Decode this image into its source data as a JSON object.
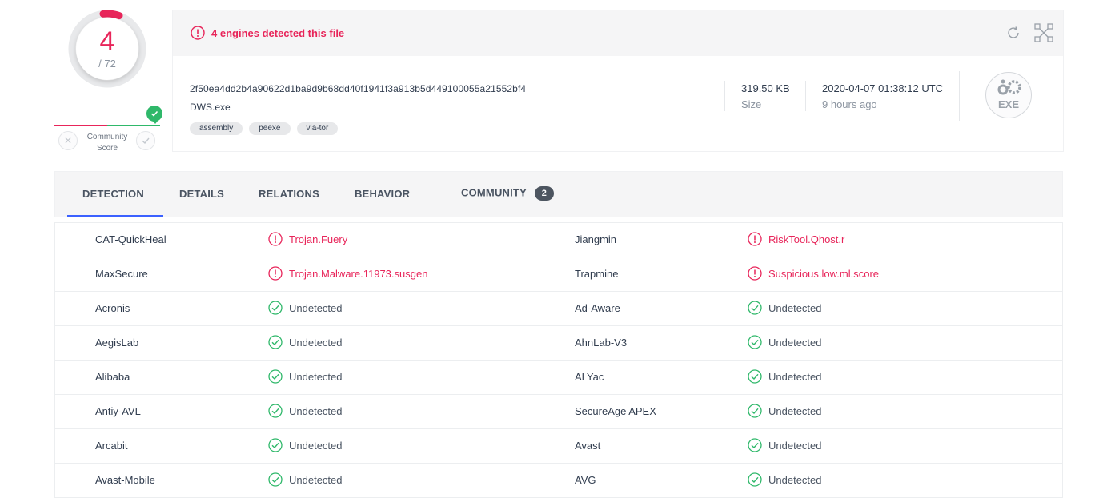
{
  "score": {
    "detected": "4",
    "total": "/ 72"
  },
  "community": {
    "label_line1": "Community",
    "label_line2": "Score"
  },
  "header": {
    "alert": "4 engines detected this file",
    "hash": "2f50ea4dd2b4a90622d1ba9d9b68dd40f1941f3a913b5d449100055a21552bf4",
    "filename": "DWS.exe",
    "tags": [
      "assembly",
      "peexe",
      "via-tor"
    ],
    "size_value": "319.50 KB",
    "size_label": "Size",
    "date_value": "2020-04-07 01:38:12 UTC",
    "date_label": "9 hours ago",
    "file_type": "EXE"
  },
  "tabs": [
    {
      "label": "DETECTION"
    },
    {
      "label": "DETAILS"
    },
    {
      "label": "RELATIONS"
    },
    {
      "label": "BEHAVIOR"
    },
    {
      "label": "COMMUNITY",
      "badge": "2"
    }
  ],
  "colors": {
    "malicious": "#e8255a",
    "clean": "#2fb86a",
    "active_tab": "#3b61ff"
  },
  "detections": [
    [
      {
        "engine": "CAT-QuickHeal",
        "result": "Trojan.Fuery",
        "status": "malicious"
      },
      {
        "engine": "Jiangmin",
        "result": "RiskTool.Qhost.r",
        "status": "malicious"
      }
    ],
    [
      {
        "engine": "MaxSecure",
        "result": "Trojan.Malware.11973.susgen",
        "status": "malicious"
      },
      {
        "engine": "Trapmine",
        "result": "Suspicious.low.ml.score",
        "status": "malicious"
      }
    ],
    [
      {
        "engine": "Acronis",
        "result": "Undetected",
        "status": "clean"
      },
      {
        "engine": "Ad-Aware",
        "result": "Undetected",
        "status": "clean"
      }
    ],
    [
      {
        "engine": "AegisLab",
        "result": "Undetected",
        "status": "clean"
      },
      {
        "engine": "AhnLab-V3",
        "result": "Undetected",
        "status": "clean"
      }
    ],
    [
      {
        "engine": "Alibaba",
        "result": "Undetected",
        "status": "clean"
      },
      {
        "engine": "ALYac",
        "result": "Undetected",
        "status": "clean"
      }
    ],
    [
      {
        "engine": "Antiy-AVL",
        "result": "Undetected",
        "status": "clean"
      },
      {
        "engine": "SecureAge APEX",
        "result": "Undetected",
        "status": "clean"
      }
    ],
    [
      {
        "engine": "Arcabit",
        "result": "Undetected",
        "status": "clean"
      },
      {
        "engine": "Avast",
        "result": "Undetected",
        "status": "clean"
      }
    ],
    [
      {
        "engine": "Avast-Mobile",
        "result": "Undetected",
        "status": "clean"
      },
      {
        "engine": "AVG",
        "result": "Undetected",
        "status": "clean"
      }
    ]
  ]
}
